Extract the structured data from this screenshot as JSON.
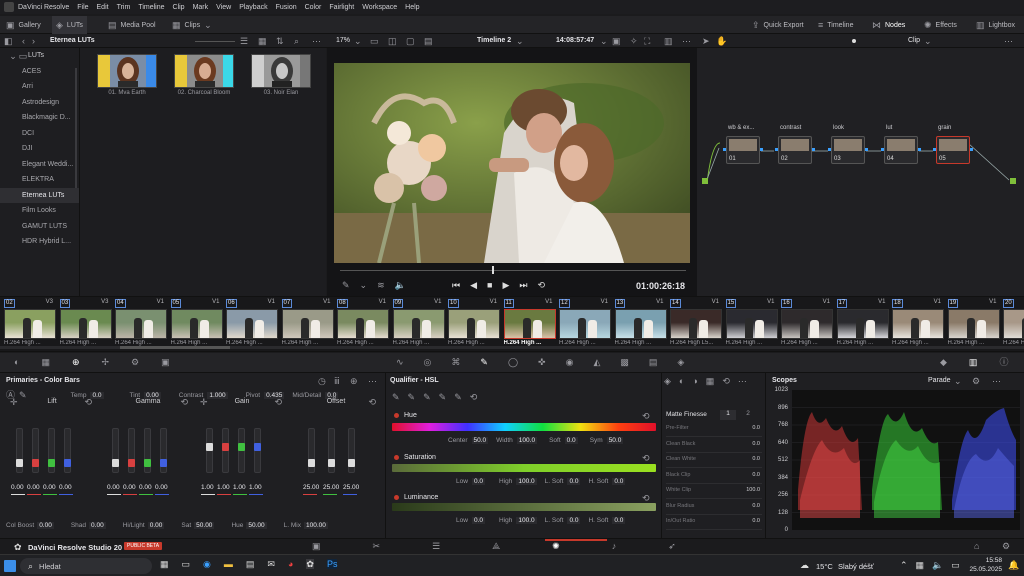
{
  "menu": {
    "app_name": "DaVinci Resolve",
    "items": [
      "File",
      "Edit",
      "Trim",
      "Timeline",
      "Clip",
      "Mark",
      "View",
      "Playback",
      "Fusion",
      "Color",
      "Fairlight",
      "Workspace",
      "Help"
    ],
    "window_title": "Eternea Luts"
  },
  "toolbar": {
    "left": [
      {
        "label": "Gallery",
        "icon": "gallery-icon"
      },
      {
        "label": "LUTs",
        "icon": "luts-icon"
      },
      {
        "label": "Media Pool",
        "icon": "media-pool-icon"
      },
      {
        "label": "Clips",
        "icon": "clips-icon"
      }
    ],
    "right": [
      {
        "label": "Quick Export",
        "icon": "export-icon"
      },
      {
        "label": "Timeline",
        "icon": "timeline-icon"
      },
      {
        "label": "Nodes",
        "icon": "nodes-icon"
      },
      {
        "label": "Effects",
        "icon": "effects-icon"
      },
      {
        "label": "Lightbox",
        "icon": "lightbox-icon"
      }
    ]
  },
  "subbar": {
    "browser_title": "Eternea LUTs",
    "zoom": "17%",
    "timeline_name": "Timeline 2",
    "timecode": "14:08:57:47",
    "node_mode": "Clip"
  },
  "lut_browser": {
    "root": "LUTs",
    "folders": [
      "ACES",
      "Arri",
      "Astrodesign",
      "Blackmagic D...",
      "DCI",
      "DJI",
      "Elegant Weddi...",
      "ELEKTRA",
      "Eternea LUTs",
      "Film Looks",
      "GAMUT LUTS",
      "HDR Hybrid L..."
    ],
    "selected": "Eternea LUTs",
    "thumbnails": [
      "01. Mva Earth",
      "02. Charcoal Bloom",
      "03. Noir Elan"
    ]
  },
  "viewer": {
    "timecode": "01:00:26:18",
    "playhead_fraction": 0.44
  },
  "nodes": [
    {
      "label": "wb & ex...",
      "num": "01"
    },
    {
      "label": "contrast",
      "num": "02"
    },
    {
      "label": "look",
      "num": "03"
    },
    {
      "label": "lut",
      "num": "04"
    },
    {
      "label": "grain",
      "num": "05"
    }
  ],
  "clips": [
    {
      "num": "02",
      "track": "V3",
      "codec": "H.264 High ..."
    },
    {
      "num": "03",
      "track": "V3",
      "codec": "H.264 High ..."
    },
    {
      "num": "04",
      "track": "V1",
      "codec": "H.264 High ..."
    },
    {
      "num": "05",
      "track": "V1",
      "codec": "H.264 High ..."
    },
    {
      "num": "06",
      "track": "V1",
      "codec": "H.264 High ..."
    },
    {
      "num": "07",
      "track": "V1",
      "codec": "H.264 High ..."
    },
    {
      "num": "08",
      "track": "V1",
      "codec": "H.264 High ..."
    },
    {
      "num": "09",
      "track": "V1",
      "codec": "H.264 High ..."
    },
    {
      "num": "10",
      "track": "V1",
      "codec": "H.264 High ..."
    },
    {
      "num": "11",
      "track": "V1",
      "codec": "H.264 High ..."
    },
    {
      "num": "12",
      "track": "V1",
      "codec": "H.264 High ..."
    },
    {
      "num": "13",
      "track": "V1",
      "codec": "H.264 High ..."
    },
    {
      "num": "14",
      "track": "V1",
      "codec": "H.264 High L5..."
    },
    {
      "num": "15",
      "track": "V1",
      "codec": "H.264 High ..."
    },
    {
      "num": "16",
      "track": "V1",
      "codec": "H.264 High ..."
    },
    {
      "num": "17",
      "track": "V1",
      "codec": "H.264 High ..."
    },
    {
      "num": "18",
      "track": "V1",
      "codec": "H.264 High ..."
    },
    {
      "num": "19",
      "track": "V1",
      "codec": "H.264 High ..."
    },
    {
      "num": "20",
      "track": "V1",
      "codec": "H.264 High ..."
    }
  ],
  "selected_clip": "11",
  "primaries": {
    "title": "Primaries - Color Bars",
    "temp_label": "Temp",
    "temp": "0.0",
    "tint_label": "Tint",
    "tint": "0.00",
    "contrast_label": "Contrast",
    "contrast": "1.000",
    "pivot_label": "Pivot",
    "pivot": "0.435",
    "middetail_label": "Mid/Detail",
    "middetail": "0.0",
    "wheels": [
      {
        "name": "Lift",
        "values": [
          "0.00",
          "0.00",
          "0.00",
          "0.00"
        ]
      },
      {
        "name": "Gamma",
        "values": [
          "0.00",
          "0.00",
          "0.00",
          "0.00"
        ]
      },
      {
        "name": "Gain",
        "values": [
          "1.00",
          "1.00",
          "1.00",
          "1.00"
        ]
      },
      {
        "name": "Offset",
        "values": [
          "25.00",
          "25.00",
          "25.00"
        ]
      }
    ],
    "bottom": [
      {
        "label": "Col Boost",
        "value": "0.00"
      },
      {
        "label": "Shad",
        "value": "0.00"
      },
      {
        "label": "Hi/Light",
        "value": "0.00"
      },
      {
        "label": "Sat",
        "value": "50.00"
      },
      {
        "label": "Hue",
        "value": "50.00"
      },
      {
        "label": "L. Mix",
        "value": "100.00"
      }
    ]
  },
  "qualifier": {
    "title": "Qualifier - HSL",
    "hue": {
      "label": "Hue",
      "center_label": "Center",
      "center": "50.0",
      "width_label": "Width",
      "width": "100.0",
      "soft_label": "Soft",
      "soft": "0.0",
      "sym_label": "Sym",
      "sym": "50.0"
    },
    "saturation": {
      "label": "Saturation",
      "low_label": "Low",
      "low": "0.0",
      "high_label": "High",
      "high": "100.0",
      "lsoft_label": "L. Soft",
      "lsoft": "0.0",
      "hsoft_label": "H. Soft",
      "hsoft": "0.0"
    },
    "luminance": {
      "label": "Luminance",
      "low_label": "Low",
      "low": "0.0",
      "high_label": "High",
      "high": "100.0",
      "lsoft_label": "L. Soft",
      "lsoft": "0.0",
      "hsoft_label": "H. Soft",
      "hsoft": "0.0"
    }
  },
  "matte_finesse": {
    "title": "Matte Finesse",
    "tab1": "1",
    "tab2": "2",
    "rows": [
      {
        "label": "Pre-Filter",
        "value": "0.0"
      },
      {
        "label": "Clean Black",
        "value": "0.0"
      },
      {
        "label": "Clean White",
        "value": "0.0"
      },
      {
        "label": "Black Clip",
        "value": "0.0"
      },
      {
        "label": "White Clip",
        "value": "100.0"
      },
      {
        "label": "Blur Radius",
        "value": "0.0"
      },
      {
        "label": "In/Out Ratio",
        "value": "0.0"
      }
    ]
  },
  "scopes": {
    "title": "Scopes",
    "mode": "Parade",
    "scale": [
      "1023",
      "896",
      "768",
      "640",
      "512",
      "384",
      "256",
      "128",
      "0"
    ]
  },
  "footer": {
    "product": "DaVinci Resolve Studio 20",
    "badge": "PUBLIC BETA"
  },
  "taskbar": {
    "search_placeholder": "Hledat",
    "weather": "15°C",
    "weather_desc": "Slabý déšť",
    "time": "15:58",
    "date": "25.05.2025"
  },
  "colors": {
    "accent": "#c7392b",
    "node_green": "#7fbf3a",
    "clip_border": "#5b8ad8"
  }
}
